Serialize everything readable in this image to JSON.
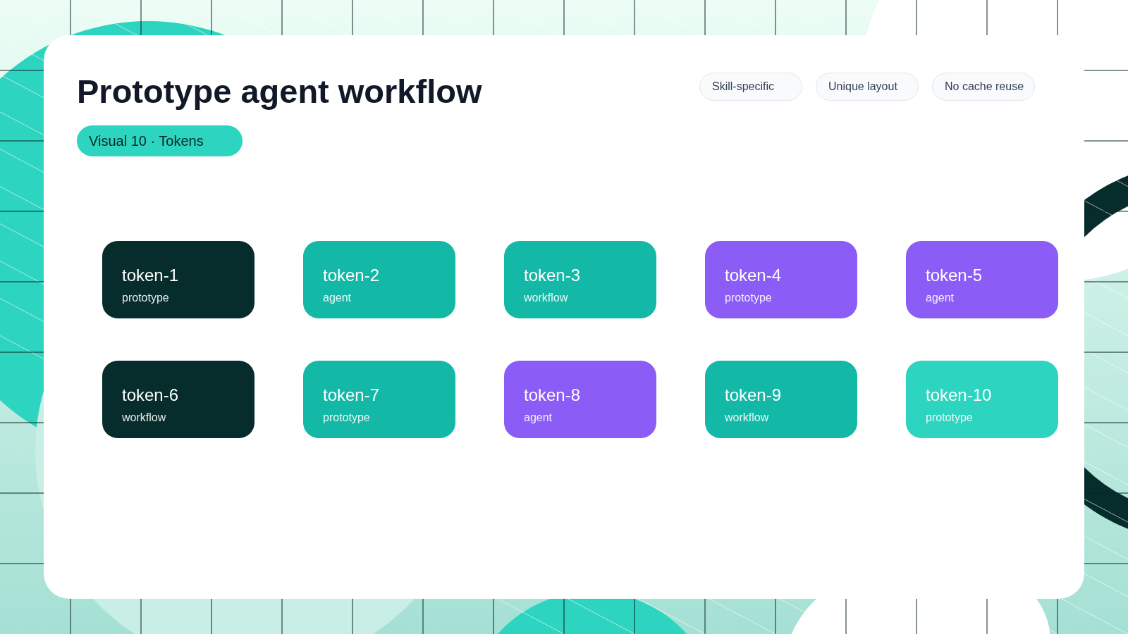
{
  "title": "Prototype agent workflow",
  "badge": "Visual 10 · Tokens",
  "chips": [
    "Skill-specific",
    "Unique layout",
    "No cache reuse"
  ],
  "tokens": [
    {
      "name": "token-1",
      "label": "prototype",
      "color": "#072c2c"
    },
    {
      "name": "token-2",
      "label": "agent",
      "color": "#14b8a6"
    },
    {
      "name": "token-3",
      "label": "workflow",
      "color": "#14b8a6"
    },
    {
      "name": "token-4",
      "label": "prototype",
      "color": "#8b5cf6"
    },
    {
      "name": "token-5",
      "label": "agent",
      "color": "#8b5cf6"
    },
    {
      "name": "token-6",
      "label": "workflow",
      "color": "#072c2c"
    },
    {
      "name": "token-7",
      "label": "prototype",
      "color": "#14b8a6"
    },
    {
      "name": "token-8",
      "label": "agent",
      "color": "#8b5cf6"
    },
    {
      "name": "token-9",
      "label": "workflow",
      "color": "#14b8a6"
    },
    {
      "name": "token-10",
      "label": "prototype",
      "color": "#2dd4bf"
    }
  ]
}
